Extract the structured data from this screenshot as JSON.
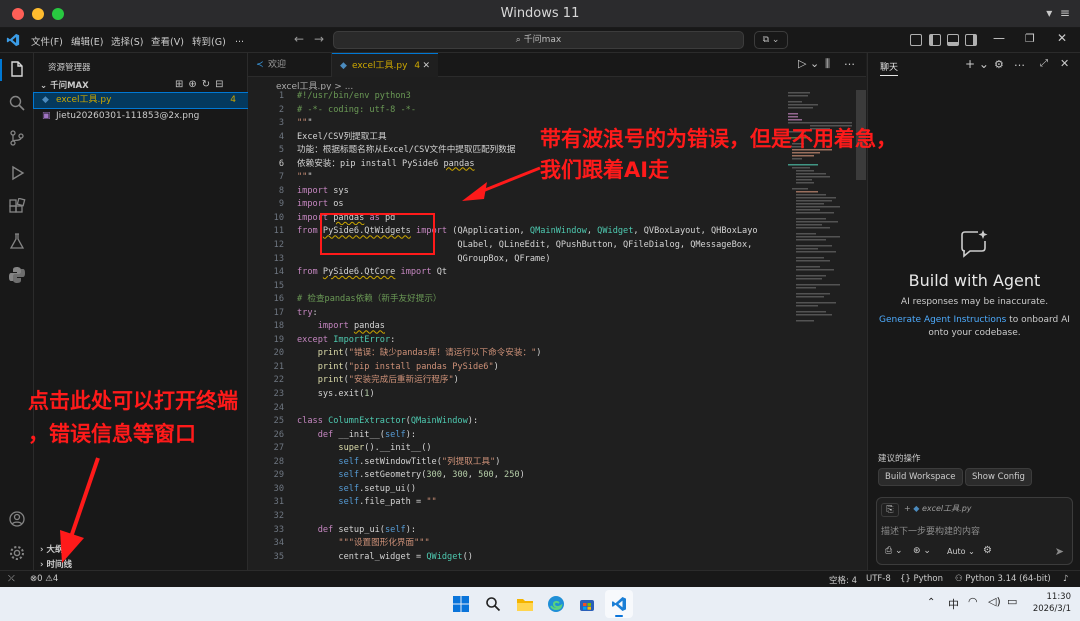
{
  "window_title": "Windows 11",
  "colors": {
    "accent": "#0078d4",
    "annotation": "#ff1a1a",
    "tl_red": "#ff5f57",
    "tl_yellow": "#febc2e",
    "tl_green": "#28c840"
  },
  "menu": [
    "文件(F)",
    "编辑(E)",
    "选择(S)",
    "查看(V)",
    "转到(G)",
    "..."
  ],
  "command_center": {
    "text": "千问max",
    "icon": "search-icon"
  },
  "explorer": {
    "title": "资源管理器",
    "folder": "千问MAX",
    "files": [
      {
        "name": "excel工具.py",
        "badge": "4",
        "icon": "python-file-icon"
      },
      {
        "name": "Jietu20260301-111853@2x.png",
        "badge": "",
        "icon": "image-file-icon"
      }
    ],
    "sections": [
      "大纲",
      "时间线"
    ]
  },
  "tabs": [
    {
      "label": "欢迎",
      "badge": "",
      "icon": "vscode-icon"
    },
    {
      "label": "excel工具.py",
      "badge": "4",
      "icon": "python-file-icon"
    }
  ],
  "breadcrumb": "excel工具.py > ...",
  "code": {
    "current_line": 6,
    "lines": [
      "#!/usr/bin/env python3",
      "# -*- coding: utf-8 -*-",
      "\"\"\"",
      "Excel/CSV列提取工具",
      "功能：根据标题名称从Excel/CSV文件中提取匹配列数据",
      "依赖安装：pip install PySide6 pandas",
      "\"\"\"",
      "import sys",
      "import os",
      "import pandas as pd",
      "from PySide6.QtWidgets import (QApplication, QMainWindow, QWidget, QVBoxLayout, QHBoxLayo",
      "                               QLabel, QLineEdit, QPushButton, QFileDialog, QMessageBox,",
      "                               QGroupBox, QFrame)",
      "from PySide6.QtCore import Qt",
      "",
      "# 检查pandas依赖（新手友好提示）",
      "try:",
      "    import pandas",
      "except ImportError:",
      "    print(\"错误：缺少pandas库！请运行以下命令安装：\")",
      "    print(\"pip install pandas PySide6\")",
      "    print(\"安装完成后重新运行程序\")",
      "    sys.exit(1)",
      "",
      "class ColumnExtractor(QMainWindow):",
      "    def __init__(self):",
      "        super().__init__()",
      "        self.setWindowTitle(\"列提取工具\")",
      "        self.setGeometry(300, 300, 500, 250)",
      "        self.setup_ui()",
      "        self.file_path = \"\"",
      "",
      "    def setup_ui(self):",
      "        \"\"\"设置图形化界面\"\"\"",
      "        central_widget = QWidget()"
    ]
  },
  "chat": {
    "tab": "聊天",
    "heading": "Build with Agent",
    "disclaimer": "AI responses may be inaccurate.",
    "link": "Generate Agent Instructions",
    "link_suffix": " to onboard AI onto your codebase.",
    "suggest_title": "建议的操作",
    "suggest_buttons": [
      "Build Workspace",
      "Show Config"
    ],
    "attachment": "excel工具.py",
    "input_placeholder": "描述下一步要构建的内容",
    "mode": "Auto"
  },
  "status": {
    "errors": "0",
    "warnings": "4",
    "spaces": "空格: 4",
    "encoding": "UTF-8",
    "language": "Python",
    "interpreter": "Python 3.14 (64-bit)"
  },
  "taskbar": {
    "ime": "中",
    "time": "11:30",
    "date": "2026/3/1"
  },
  "annotations": {
    "top_line1": "带有波浪号的为错误，但是不用着急，",
    "top_line2": "我们跟着AI走",
    "left_line1": "点击此处可以打开终端",
    "left_line2": "，错误信息等窗口"
  }
}
